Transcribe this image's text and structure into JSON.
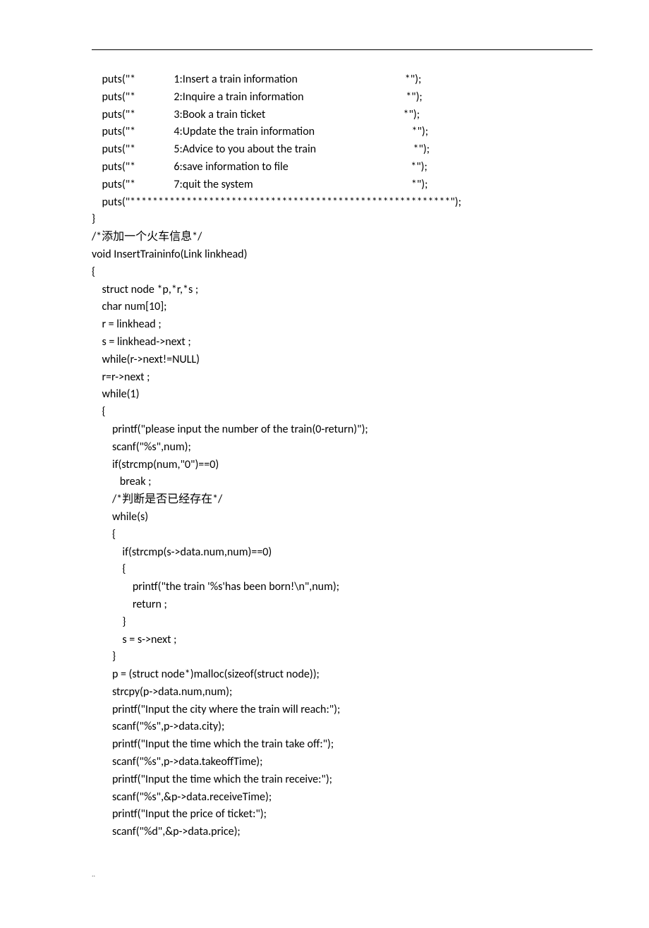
{
  "code": {
    "lines": [
      "    puts(\"*               1:Insert a train information                                          *\");",
      "    puts(\"*               2:Inquire a train information                                        *\");",
      "    puts(\"*               3:Book a train ticket                                                      *\");",
      "    puts(\"*               4:Update the train information                                      *\");",
      "    puts(\"*               5:Advice to you about the train                                      *\");",
      "    puts(\"*               6:save information to file                                                *\");",
      "    puts(\"*               7:quit the system                                                              *\");",
      "    puts(\"*********************************************************\");",
      "}",
      "/*添加一个火车信息*/",
      "void InsertTraininfo(Link linkhead)",
      "{",
      "    struct node *p,*r,*s ;",
      "    char num[10];",
      "    r = linkhead ;",
      "    s = linkhead->next ;",
      "    while(r->next!=NULL)",
      "    r=r->next ;",
      "    while(1)",
      "    {",
      "        printf(\"please input the number of the train(0-return)\");",
      "        scanf(\"%s\",num);",
      "        if(strcmp(num,\"0\")==0)",
      "           break ;",
      "        /*判断是否已经存在*/",
      "        while(s)",
      "        {",
      "            if(strcmp(s->data.num,num)==0)",
      "            {",
      "                printf(\"the train '%s'has been born!\\n\",num);",
      "                return ;",
      "            }",
      "            s = s->next ;",
      "        }",
      "        p = (struct node*)malloc(sizeof(struct node));",
      "        strcpy(p->data.num,num);",
      "        printf(\"Input the city where the train will reach:\");",
      "        scanf(\"%s\",p->data.city);",
      "        printf(\"Input the time which the train take off:\");",
      "        scanf(\"%s\",p->data.takeoffTime);",
      "        printf(\"Input the time which the train receive:\");",
      "        scanf(\"%s\",&p->data.receiveTime);",
      "        printf(\"Input the price of ticket:\");",
      "        scanf(\"%d\",&p->data.price);"
    ]
  },
  "footer": {
    "dots": ".."
  }
}
